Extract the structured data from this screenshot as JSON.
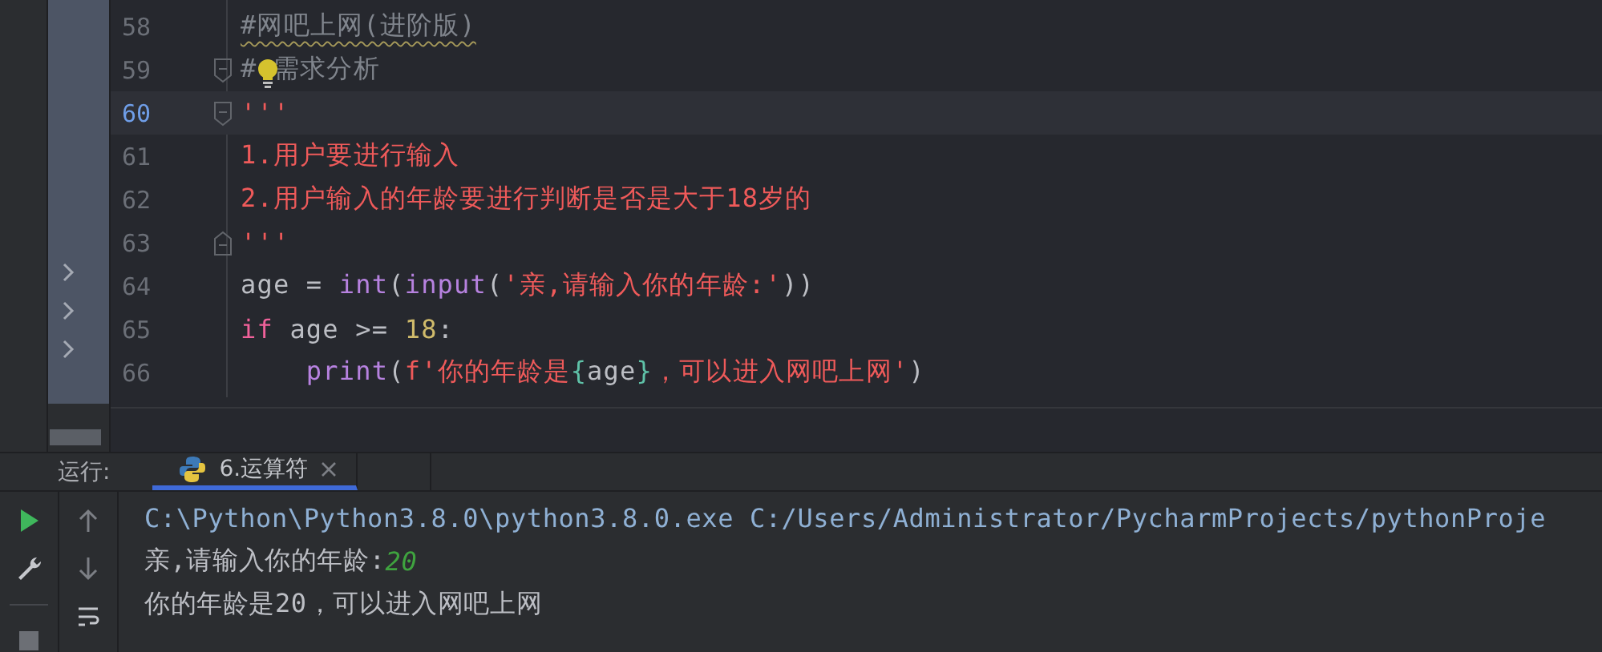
{
  "editor": {
    "lines": [
      {
        "number": "58",
        "current": false,
        "tokens": [
          {
            "text": "#网吧上网(进阶版)",
            "kind": "comment-typo"
          }
        ]
      },
      {
        "number": "59",
        "current": false,
        "fold_start": true,
        "intention_bulb": true,
        "tokens": [
          {
            "text": "# 需求分析",
            "kind": "comment"
          }
        ]
      },
      {
        "number": "60",
        "current": true,
        "fold_start": true,
        "tokens": [
          {
            "text": "'''",
            "kind": "string"
          }
        ]
      },
      {
        "number": "61",
        "current": false,
        "tokens": [
          {
            "text": "1.用户要进行输入",
            "kind": "string"
          }
        ]
      },
      {
        "number": "62",
        "current": false,
        "tokens": [
          {
            "text": "2.用户输入的年龄要进行判断是否是大于18岁的",
            "kind": "string"
          }
        ]
      },
      {
        "number": "63",
        "current": false,
        "fold_end": true,
        "tokens": [
          {
            "text": "'''",
            "kind": "string"
          }
        ]
      },
      {
        "number": "64",
        "current": false,
        "tokens": [
          {
            "text": "age = ",
            "kind": "plain"
          },
          {
            "text": "int",
            "kind": "builtin"
          },
          {
            "text": "(",
            "kind": "plain"
          },
          {
            "text": "input",
            "kind": "builtin"
          },
          {
            "text": "(",
            "kind": "plain"
          },
          {
            "text": "'亲,请输入你的年龄:'",
            "kind": "string"
          },
          {
            "text": "))",
            "kind": "plain"
          }
        ]
      },
      {
        "number": "65",
        "current": false,
        "tokens": [
          {
            "text": "if",
            "kind": "keyword"
          },
          {
            "text": " age >= ",
            "kind": "plain"
          },
          {
            "text": "18",
            "kind": "number"
          },
          {
            "text": ":",
            "kind": "plain"
          }
        ]
      },
      {
        "number": "66",
        "current": false,
        "tokens": [
          {
            "text": "    print",
            "kind": "builtin"
          },
          {
            "text": "(",
            "kind": "plain"
          },
          {
            "text": "f'你的年龄是",
            "kind": "string"
          },
          {
            "text": "{",
            "kind": "brace"
          },
          {
            "text": "age",
            "kind": "plain"
          },
          {
            "text": "}",
            "kind": "brace"
          },
          {
            "text": "，可以进入网吧上网'",
            "kind": "string"
          },
          {
            "text": ")",
            "kind": "plain"
          }
        ]
      }
    ]
  },
  "run_panel": {
    "label": "运行:",
    "tabs": [
      {
        "label": "6.运算符",
        "selected": true
      }
    ],
    "console": [
      {
        "kind": "command",
        "text": "C:\\Python\\Python3.8.0\\python3.8.0.exe C:/Users/Administrator/PycharmProjects/pythonProje"
      },
      {
        "kind": "prompt",
        "text": "亲,请输入你的年龄:",
        "input": "20"
      },
      {
        "kind": "output",
        "text": "你的年龄是20，可以进入网吧上网"
      }
    ]
  }
}
